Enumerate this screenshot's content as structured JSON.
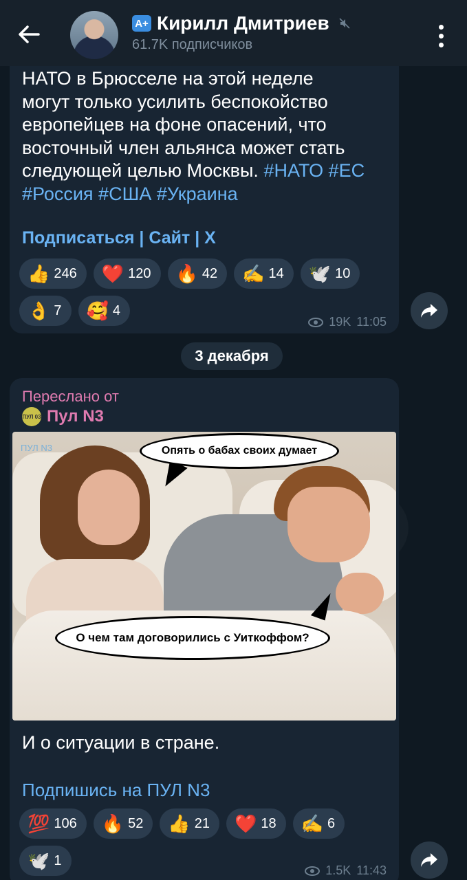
{
  "header": {
    "back_icon": "arrow-left-icon",
    "badge": "A+",
    "channel_name": "Кирилл Дмитриев",
    "subscribers": "61.7K подписчиков",
    "mute_icon": "muted-icon",
    "menu_icon": "more-vertical-icon"
  },
  "post1": {
    "text_lines": [
      "НАТО в Брюсселе на этой неделе",
      "могут только усилить беспокойство",
      "европейцев на фоне опасений, что",
      "восточный член альянса может стать",
      "следующей целью Москвы."
    ],
    "hashtags_line1": "#НАТО #ЕС",
    "hashtags_line2": "#Россия #США #Украина",
    "links": [
      "Подписаться",
      "Сайт",
      "X"
    ],
    "link_separator": " | ",
    "reactions": [
      {
        "emoji": "👍",
        "count": "246"
      },
      {
        "emoji": "❤️",
        "count": "120"
      },
      {
        "emoji": "🔥",
        "count": "42"
      },
      {
        "emoji": "✍️",
        "count": "14"
      },
      {
        "emoji": "🕊️",
        "count": "10"
      },
      {
        "emoji": "👌",
        "count": "7"
      },
      {
        "emoji": "🥰",
        "count": "4"
      }
    ],
    "views": "19K",
    "time": "11:05"
  },
  "date_separator": "3 декабря",
  "post2": {
    "forwarded_label": "Переслано от",
    "source_name": "Пул N3",
    "source_avatar_text": "ПУЛ 03",
    "meme": {
      "watermark": "ПУЛ N3",
      "bubble_top": "Опять о бабах своих думает",
      "bubble_bottom": "О чем там договорились с Уиткоффом?"
    },
    "text": "И о ситуации в стране.",
    "link": "Подпишись на ПУЛ N3",
    "reactions": [
      {
        "emoji": "💯",
        "count": "106"
      },
      {
        "emoji": "🔥",
        "count": "52"
      },
      {
        "emoji": "👍",
        "count": "21"
      },
      {
        "emoji": "❤️",
        "count": "18"
      },
      {
        "emoji": "✍️",
        "count": "6"
      },
      {
        "emoji": "🕊️",
        "count": "1"
      }
    ],
    "views": "1.5K",
    "time": "11:43"
  },
  "colors": {
    "background": "#0e1621",
    "header": "#17212b",
    "bubble": "#182533",
    "link": "#6ab3f3",
    "forward": "#e07bb0"
  }
}
